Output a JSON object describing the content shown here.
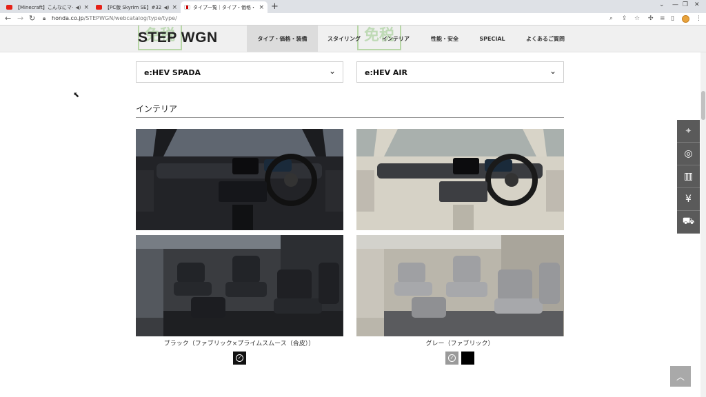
{
  "browser": {
    "tabs": [
      {
        "title": "【Minecraft】こんなにマイクラし",
        "favicon_color": "#e62117",
        "active": false
      },
      {
        "title": "【PC版 Skyrim SE】#32 森",
        "favicon_color": "#e62117",
        "active": false
      },
      {
        "title": "タイプ一覧｜タイプ・価格・装備｜ス",
        "favicon_color": "#cc0000",
        "active": true
      }
    ],
    "url_host": "honda.co.jp",
    "url_path": "/STEPWGN/webcatalog/type/type/"
  },
  "site": {
    "logo": "STEP WGN",
    "tax_badge": "免税",
    "nav": [
      {
        "label": "タイプ・価格・装備",
        "active": true
      },
      {
        "label": "スタイリング",
        "active": false
      },
      {
        "label": "インテリア",
        "active": false
      },
      {
        "label": "性能・安全",
        "active": false
      },
      {
        "label": "SPECIAL",
        "active": false
      },
      {
        "label": "よくあるご質問",
        "active": false
      }
    ]
  },
  "content": {
    "left_select": "e:HEV SPADA",
    "right_select": "e:HEV AIR",
    "section_title": "インテリア",
    "left_caption": "ブラック（ファブリック×プライムスムース（合皮））",
    "right_caption": "グレー（ファブリック）",
    "left_swatches": [
      {
        "color": "#111111",
        "selected": true
      }
    ],
    "right_swatches": [
      {
        "color": "#9a9a9a",
        "selected": true
      },
      {
        "color": "#000000",
        "selected": false
      }
    ]
  },
  "side_tools": [
    "map-pin-icon",
    "steering-wheel-icon",
    "book-icon",
    "yen-icon",
    "car-icon"
  ],
  "colors": {
    "accent_gray": "#5a5a5a",
    "nav_bg": "#f0f0f0"
  }
}
